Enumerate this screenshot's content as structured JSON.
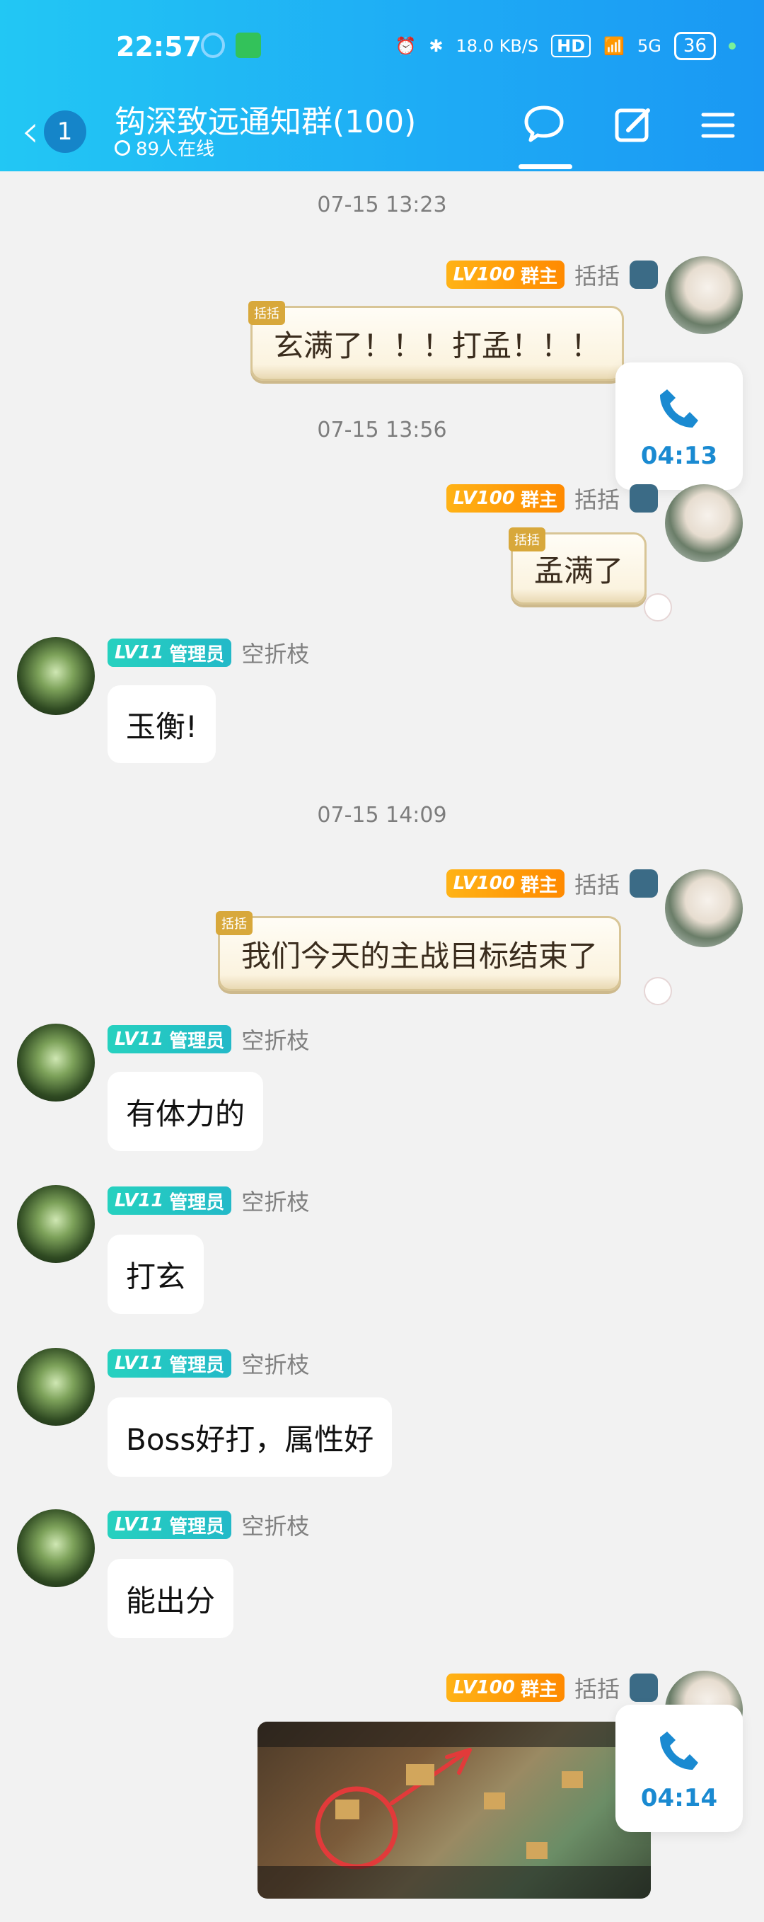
{
  "status": {
    "time": "22:57",
    "net_speed": "18.0 KB/S",
    "hd": "HD",
    "signal": "5G",
    "battery": "36"
  },
  "header": {
    "unread_count": "1",
    "group_name": "钩深致远通知群(100)",
    "online": "89人在线"
  },
  "messages": {
    "ts1": "07-15 13:23",
    "ts2": "07-15 13:56",
    "ts3": "07-15 14:09",
    "owner": {
      "lv": "LV100",
      "role": "群主",
      "name": "括括"
    },
    "admin": {
      "lv": "LV11",
      "role": "管理员",
      "name": "空折枝"
    },
    "tag": "括括",
    "m1": "玄满了！！！打孟！！！",
    "m2": "孟满了",
    "m3": "玉衡!",
    "m4": "我们今天的主战目标结束了",
    "m5": "有体力的",
    "m6": "打玄",
    "m7": "Boss好打，属性好",
    "m8": "能出分"
  },
  "calls": {
    "call1": "04:13",
    "call2": "04:14"
  },
  "colors": {
    "header_start": "#22c7f4",
    "header_end": "#1a98f3",
    "owner_badge": "#ffa20a",
    "admin_badge": "#25c9c4",
    "call_blue": "#1a8ad1"
  }
}
